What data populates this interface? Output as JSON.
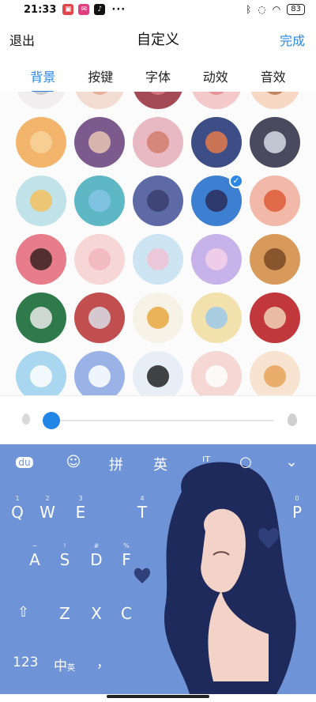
{
  "status_bar": {
    "time": "21:33",
    "dots": "···",
    "battery": "83"
  },
  "header": {
    "exit_label": "退出",
    "title": "自定义",
    "done_label": "完成"
  },
  "tabs": [
    {
      "label": "背景",
      "active": true
    },
    {
      "label": "按键",
      "active": false
    },
    {
      "label": "字体",
      "active": false
    },
    {
      "label": "动效",
      "active": false
    },
    {
      "label": "音效",
      "active": false
    }
  ],
  "backgrounds": {
    "selected_index": 13,
    "items": [
      {
        "bg": "#f0eeee",
        "face": "#c9c3c6"
      },
      {
        "bg": "#f3ddd2",
        "face": "#e4a891"
      },
      {
        "bg": "#a44a57",
        "face": "#d97c86"
      },
      {
        "bg": "#f4c9c9",
        "face": "#e58a8f"
      },
      {
        "bg": "#f6d8c4",
        "face": "#b7784e"
      },
      {
        "bg": "#f3b56b",
        "face": "#f7d29a"
      },
      {
        "bg": "#7c5a8e",
        "face": "#e6c5b5"
      },
      {
        "bg": "#e8b8c3",
        "face": "#d47d6f"
      },
      {
        "bg": "#3d4e86",
        "face": "#e37b4c"
      },
      {
        "bg": "#4a4a5e",
        "face": "#d7dce6"
      },
      {
        "bg": "#bfe3e8",
        "face": "#f3c060"
      },
      {
        "bg": "#5db7c4",
        "face": "#86c4e6"
      },
      {
        "bg": "#5e6aa6",
        "face": "#3a3f6e"
      },
      {
        "bg": "#3d7fd1",
        "face": "#2b2d5c"
      },
      {
        "bg": "#f2b9a8",
        "face": "#de5c3a"
      },
      {
        "bg": "#e77c8a",
        "face": "#3a2222"
      },
      {
        "bg": "#f7d6d6",
        "face": "#f1b7bd"
      },
      {
        "bg": "#cde4f3",
        "face": "#f1c3d6"
      },
      {
        "bg": "#c7b3ea",
        "face": "#f3d1e8"
      },
      {
        "bg": "#d89a5a",
        "face": "#7a4a26"
      },
      {
        "bg": "#2f7a4a",
        "face": "#e9e9e9"
      },
      {
        "bg": "#c24f4f",
        "face": "#d9dde5"
      },
      {
        "bg": "#f6f2e6",
        "face": "#e7a83d"
      },
      {
        "bg": "#f3e1ad",
        "face": "#9bc9ea"
      },
      {
        "bg": "#c2373b",
        "face": "#f0d2b8"
      },
      {
        "bg": "#a8d7ef",
        "face": "#ffffff"
      },
      {
        "bg": "#9ab2e6",
        "face": "#ffffff"
      },
      {
        "bg": "#e8eef6",
        "face": "#222222"
      },
      {
        "bg": "#f5d7d4",
        "face": "#ffffff"
      },
      {
        "bg": "#f7e3d0",
        "face": "#e8a45a"
      }
    ]
  },
  "slider": {
    "value": 0.03,
    "colors": {
      "drop_left": "#d9d9d9",
      "drop_right": "#d0d0d0",
      "knob": "#2286e6"
    }
  },
  "keyboard": {
    "colors": {
      "background": "#6e93d6"
    },
    "toolbar": [
      {
        "icon": "du-logo-icon",
        "glyph": "du"
      },
      {
        "icon": "emoji-icon",
        "glyph": "☺"
      },
      {
        "icon": "pinyin-mode",
        "glyph": "拼"
      },
      {
        "icon": "english-mode",
        "glyph": "英"
      },
      {
        "icon": "cursor-icon",
        "glyph": "ᴵᵀ"
      },
      {
        "icon": "search-icon",
        "glyph": "○"
      },
      {
        "icon": "collapse-keyboard-icon",
        "glyph": "⌄"
      }
    ],
    "row1": [
      {
        "sup": "1",
        "label": "Q"
      },
      {
        "sup": "2",
        "label": "W"
      },
      {
        "sup": "3",
        "label": "E"
      },
      {
        "sup": "4",
        "label": "T"
      },
      {
        "sup": "0",
        "label": "P"
      }
    ],
    "row2": [
      {
        "sup": "~",
        "label": "A"
      },
      {
        "sup": "!",
        "label": "S"
      },
      {
        "sup": "#",
        "label": "D"
      },
      {
        "sup": "%",
        "label": "F"
      }
    ],
    "row3": [
      {
        "sup": "",
        "label": "Z"
      },
      {
        "sup": "",
        "label": "X"
      },
      {
        "sup": "",
        "label": "C"
      }
    ],
    "shift_glyph": "⇧",
    "num_key": "123",
    "lang_key": "中",
    "lang_key_sub": "英",
    "comma_key": "，"
  }
}
